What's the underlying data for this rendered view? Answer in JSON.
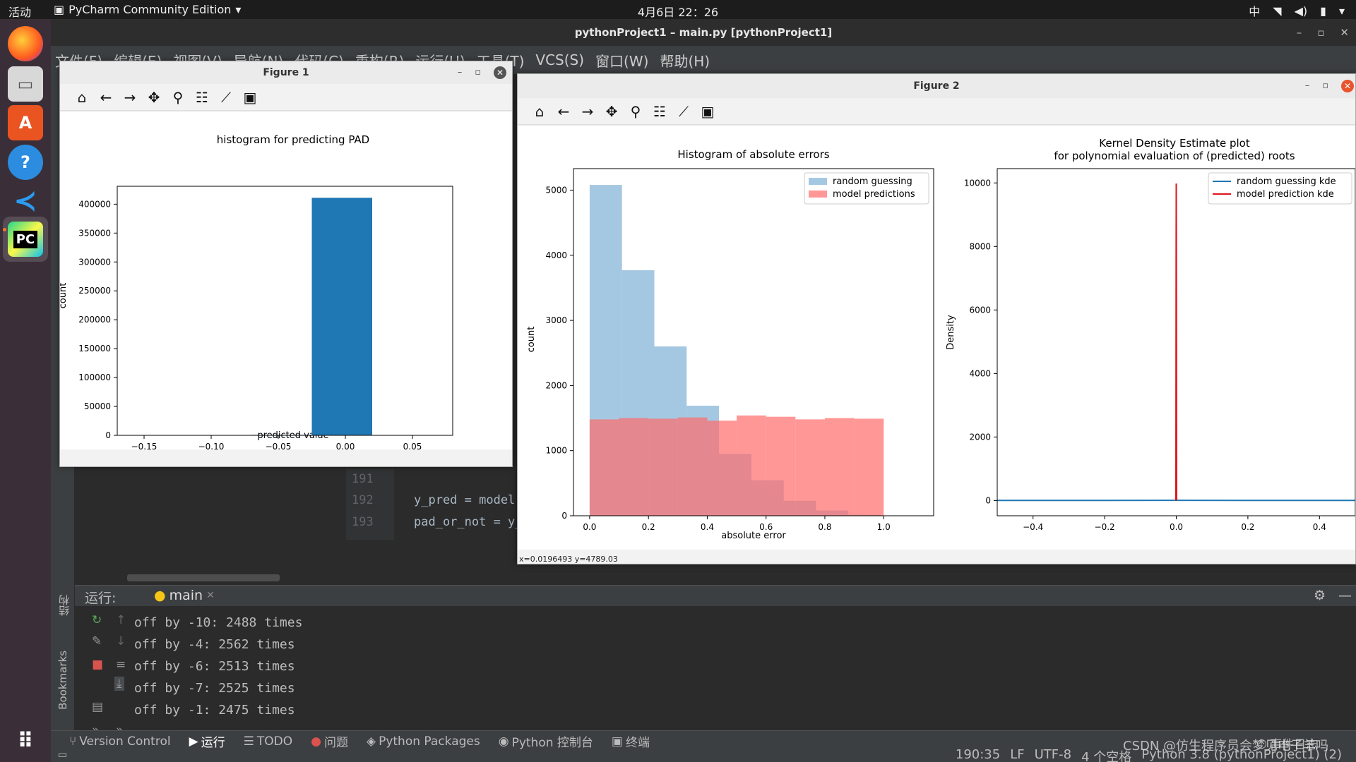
{
  "topbar": {
    "activities": "活动",
    "app_name": "PyCharm Community Edition",
    "clock": "4月6日  22：26",
    "input_method": "中"
  },
  "ide": {
    "title": "pythonProject1 – main.py [pythonProject1]",
    "menu": [
      "文件(F)",
      "编辑(E)",
      "视图(V)",
      "导航(N)",
      "代码(C)",
      "重构(R)",
      "运行(U)",
      "工具(T)",
      "VCS(S)",
      "窗口(W)",
      "帮助(H)"
    ],
    "editor": {
      "lines": [
        {
          "num": "191",
          "code": ""
        },
        {
          "num": "192",
          "code": "y_pred = model.pr"
        },
        {
          "num": "193",
          "code": "pad_or_not = y_pr"
        }
      ]
    },
    "run": {
      "label": "运行:",
      "tab": "main",
      "side_label_structure": "结构",
      "side_label_bookmarks": "Bookmarks",
      "console": [
        "off by -10: 2488 times",
        "off by -4: 2562 times",
        "off by -6: 2513 times",
        "off by -7: 2525 times",
        "off by -1: 2475 times"
      ]
    },
    "toolwindows": [
      "Version Control",
      "运行",
      "TODO",
      "问题",
      "Python Packages",
      "Python 控制台",
      "终端"
    ],
    "event_log": "事件日志",
    "status": [
      "190:35",
      "LF",
      "UTF-8",
      "4 个空格",
      "Python 3.8 (pythonProject1) (2)"
    ],
    "watermark": "CSDN @仿生程序员会梦见电子羊吗"
  },
  "figure1": {
    "window_title": "Figure 1",
    "chart_data": {
      "type": "bar",
      "title": "histogram for predicting PAD",
      "xlabel": "predicted value",
      "ylabel": "count",
      "x_ticks": [
        "−0.15",
        "−0.10",
        "−0.05",
        "0.00",
        "0.05"
      ],
      "y_ticks": [
        "0",
        "50000",
        "100000",
        "150000",
        "200000",
        "250000",
        "300000",
        "350000",
        "400000"
      ],
      "bars": [
        {
          "x0": -0.07,
          "x1": -0.025,
          "value": 800
        },
        {
          "x0": -0.025,
          "x1": 0.02,
          "value": 411000
        }
      ],
      "xlim": [
        -0.17,
        0.08
      ],
      "ylim": [
        0,
        431000
      ]
    }
  },
  "figure2": {
    "window_title": "Figure 2",
    "status": "x=0.0196493    y=4789.03",
    "chart_data": [
      {
        "type": "bar",
        "title": "Histogram of absolute errors",
        "xlabel": "absolute error",
        "ylabel": "count",
        "x_ticks": [
          "0.0",
          "0.2",
          "0.4",
          "0.6",
          "0.8",
          "1.0"
        ],
        "y_ticks": [
          "0",
          "1000",
          "2000",
          "3000",
          "4000",
          "5000"
        ],
        "xlim": [
          -0.055,
          1.17
        ],
        "ylim": [
          0,
          5330
        ],
        "legend": "top-right",
        "series": [
          {
            "name": "random guessing",
            "color": "#7fb0d5",
            "edges": [
              0.0,
              0.11,
              0.22,
              0.33,
              0.44,
              0.55,
              0.66,
              0.77,
              0.88,
              0.99,
              1.1
            ],
            "values": [
              5080,
              3770,
              2600,
              1690,
              950,
              545,
              230,
              80,
              17,
              2
            ]
          },
          {
            "name": "model predictions",
            "color": "#ff6b6b",
            "edges": [
              0.0,
              0.1,
              0.2,
              0.3,
              0.4,
              0.5,
              0.6,
              0.7,
              0.8,
              0.9,
              1.0
            ],
            "values": [
              1480,
              1500,
              1490,
              1510,
              1460,
              1540,
              1520,
              1480,
              1500,
              1490
            ]
          }
        ]
      },
      {
        "type": "line",
        "title": "Kernel Density Estimate plot",
        "subtitle": "for polynomial evaluation of (predicted) roots",
        "xlabel": "",
        "ylabel": "Density",
        "x_ticks": [
          "−0.4",
          "−0.2",
          "0.0",
          "0.2",
          "0.4"
        ],
        "y_ticks": [
          "0",
          "2000",
          "4000",
          "6000",
          "8000",
          "10000"
        ],
        "xlim": [
          -0.5,
          0.5
        ],
        "ylim": [
          -480,
          10450
        ],
        "legend": "top-right",
        "series": [
          {
            "name": "random guessing kde",
            "color": "#1f77b4",
            "x": [
              -0.5,
              -0.2,
              0.0,
              0.2,
              0.5
            ],
            "y": [
              2,
              4,
              5,
              4,
              2
            ]
          },
          {
            "name": "model prediction kde",
            "color": "#e0151b",
            "x": [
              -0.001,
              -0.0003,
              0.0,
              0.0003,
              0.001
            ],
            "y": [
              0,
              8000,
              9980,
              8000,
              0
            ]
          }
        ]
      }
    ]
  }
}
